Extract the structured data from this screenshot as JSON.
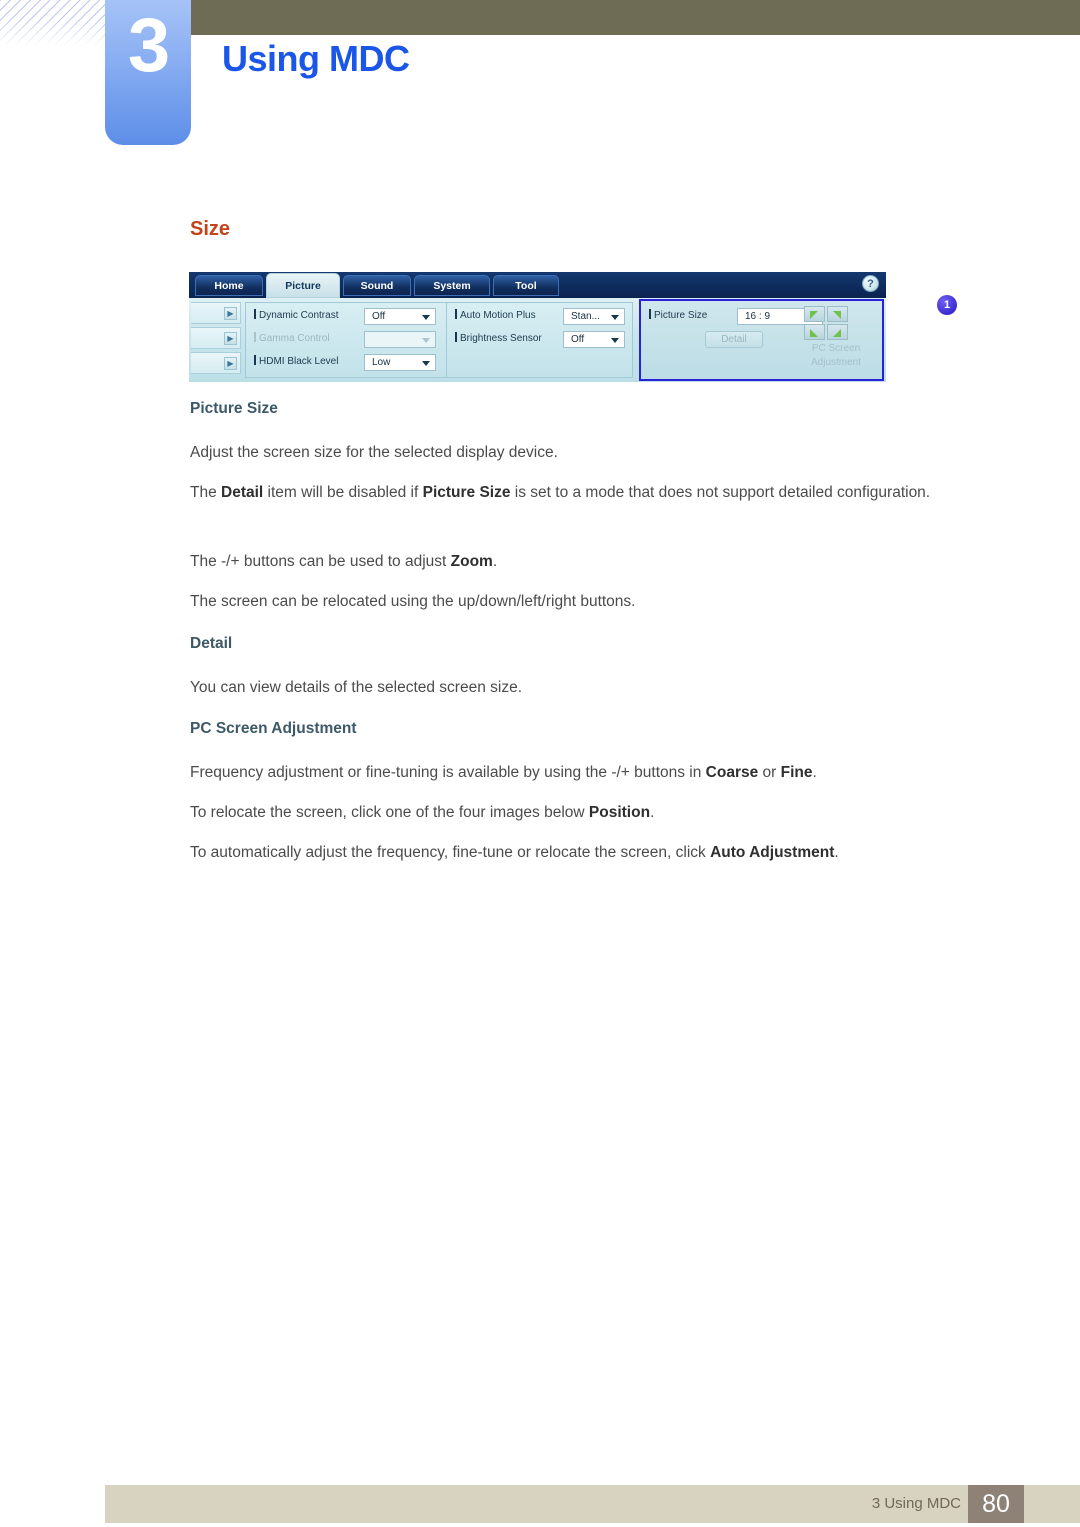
{
  "header": {
    "chapter_number": "3",
    "chapter_title": "Using MDC",
    "accent_blue": "#1a56e8",
    "badge_blue": "#7fa7f0",
    "olive": "#6f6c55"
  },
  "section": {
    "heading": "Size",
    "heading_color": "#c1441a"
  },
  "mdc_screenshot": {
    "help_icon": "question-mark-icon",
    "tabs": [
      {
        "label": "Home",
        "active": false
      },
      {
        "label": "Picture",
        "active": true
      },
      {
        "label": "Sound",
        "active": false
      },
      {
        "label": "System",
        "active": false
      },
      {
        "label": "Tool",
        "active": false
      }
    ],
    "panel_a": {
      "rows": [
        {
          "label": "Dynamic Contrast",
          "value": "Off",
          "disabled": false
        },
        {
          "label": "Gamma Control",
          "value": "",
          "disabled": true
        },
        {
          "label": "HDMI Black Level",
          "value": "Low",
          "disabled": false
        }
      ]
    },
    "panel_b": {
      "rows": [
        {
          "label": "Auto Motion Plus",
          "value": "Stan...",
          "disabled": false
        },
        {
          "label": "Brightness Sensor",
          "value": "Off",
          "disabled": false
        }
      ]
    },
    "highlight_panel": {
      "callout_number": "1",
      "picture_size_label": "Picture Size",
      "picture_size_value": "16 : 9",
      "detail_button": "Detail",
      "pc_screen_icon": "four-corner-arrows-icon",
      "pc_screen_label_line1": "PC Screen",
      "pc_screen_label_line2": "Adjustment"
    }
  },
  "content": {
    "picture_size": {
      "heading": "Picture Size",
      "p1": "Adjust the screen size for the selected display device.",
      "p2_a": "The ",
      "p2_b1": "Detail",
      "p2_c": " item will be disabled if ",
      "p2_b2": "Picture Size",
      "p2_d": " is set to a mode that does not support detailed configuration.",
      "p3_a": "The -/+ buttons can be used to adjust ",
      "p3_b": "Zoom",
      "p3_c": ".",
      "p4": "The screen can be relocated using the up/down/left/right buttons."
    },
    "detail": {
      "heading": "Detail",
      "p1": "You can view details of the selected screen size."
    },
    "pc_screen_adjustment": {
      "heading": "PC Screen Adjustment",
      "p1_a": "Frequency adjustment or fine-tuning is available by using the -/+ buttons in ",
      "p1_b1": "Coarse",
      "p1_c": " or ",
      "p1_b2": "Fine",
      "p1_d": ".",
      "p2_a": "To relocate the screen, click one of the four images below ",
      "p2_b": "Position",
      "p2_c": ".",
      "p3_a": "To automatically adjust the frequency, fine-tune or relocate the screen, click ",
      "p3_b": "Auto Adjustment",
      "p3_c": "."
    }
  },
  "footer": {
    "label": "3 Using MDC",
    "page_number": "80"
  }
}
